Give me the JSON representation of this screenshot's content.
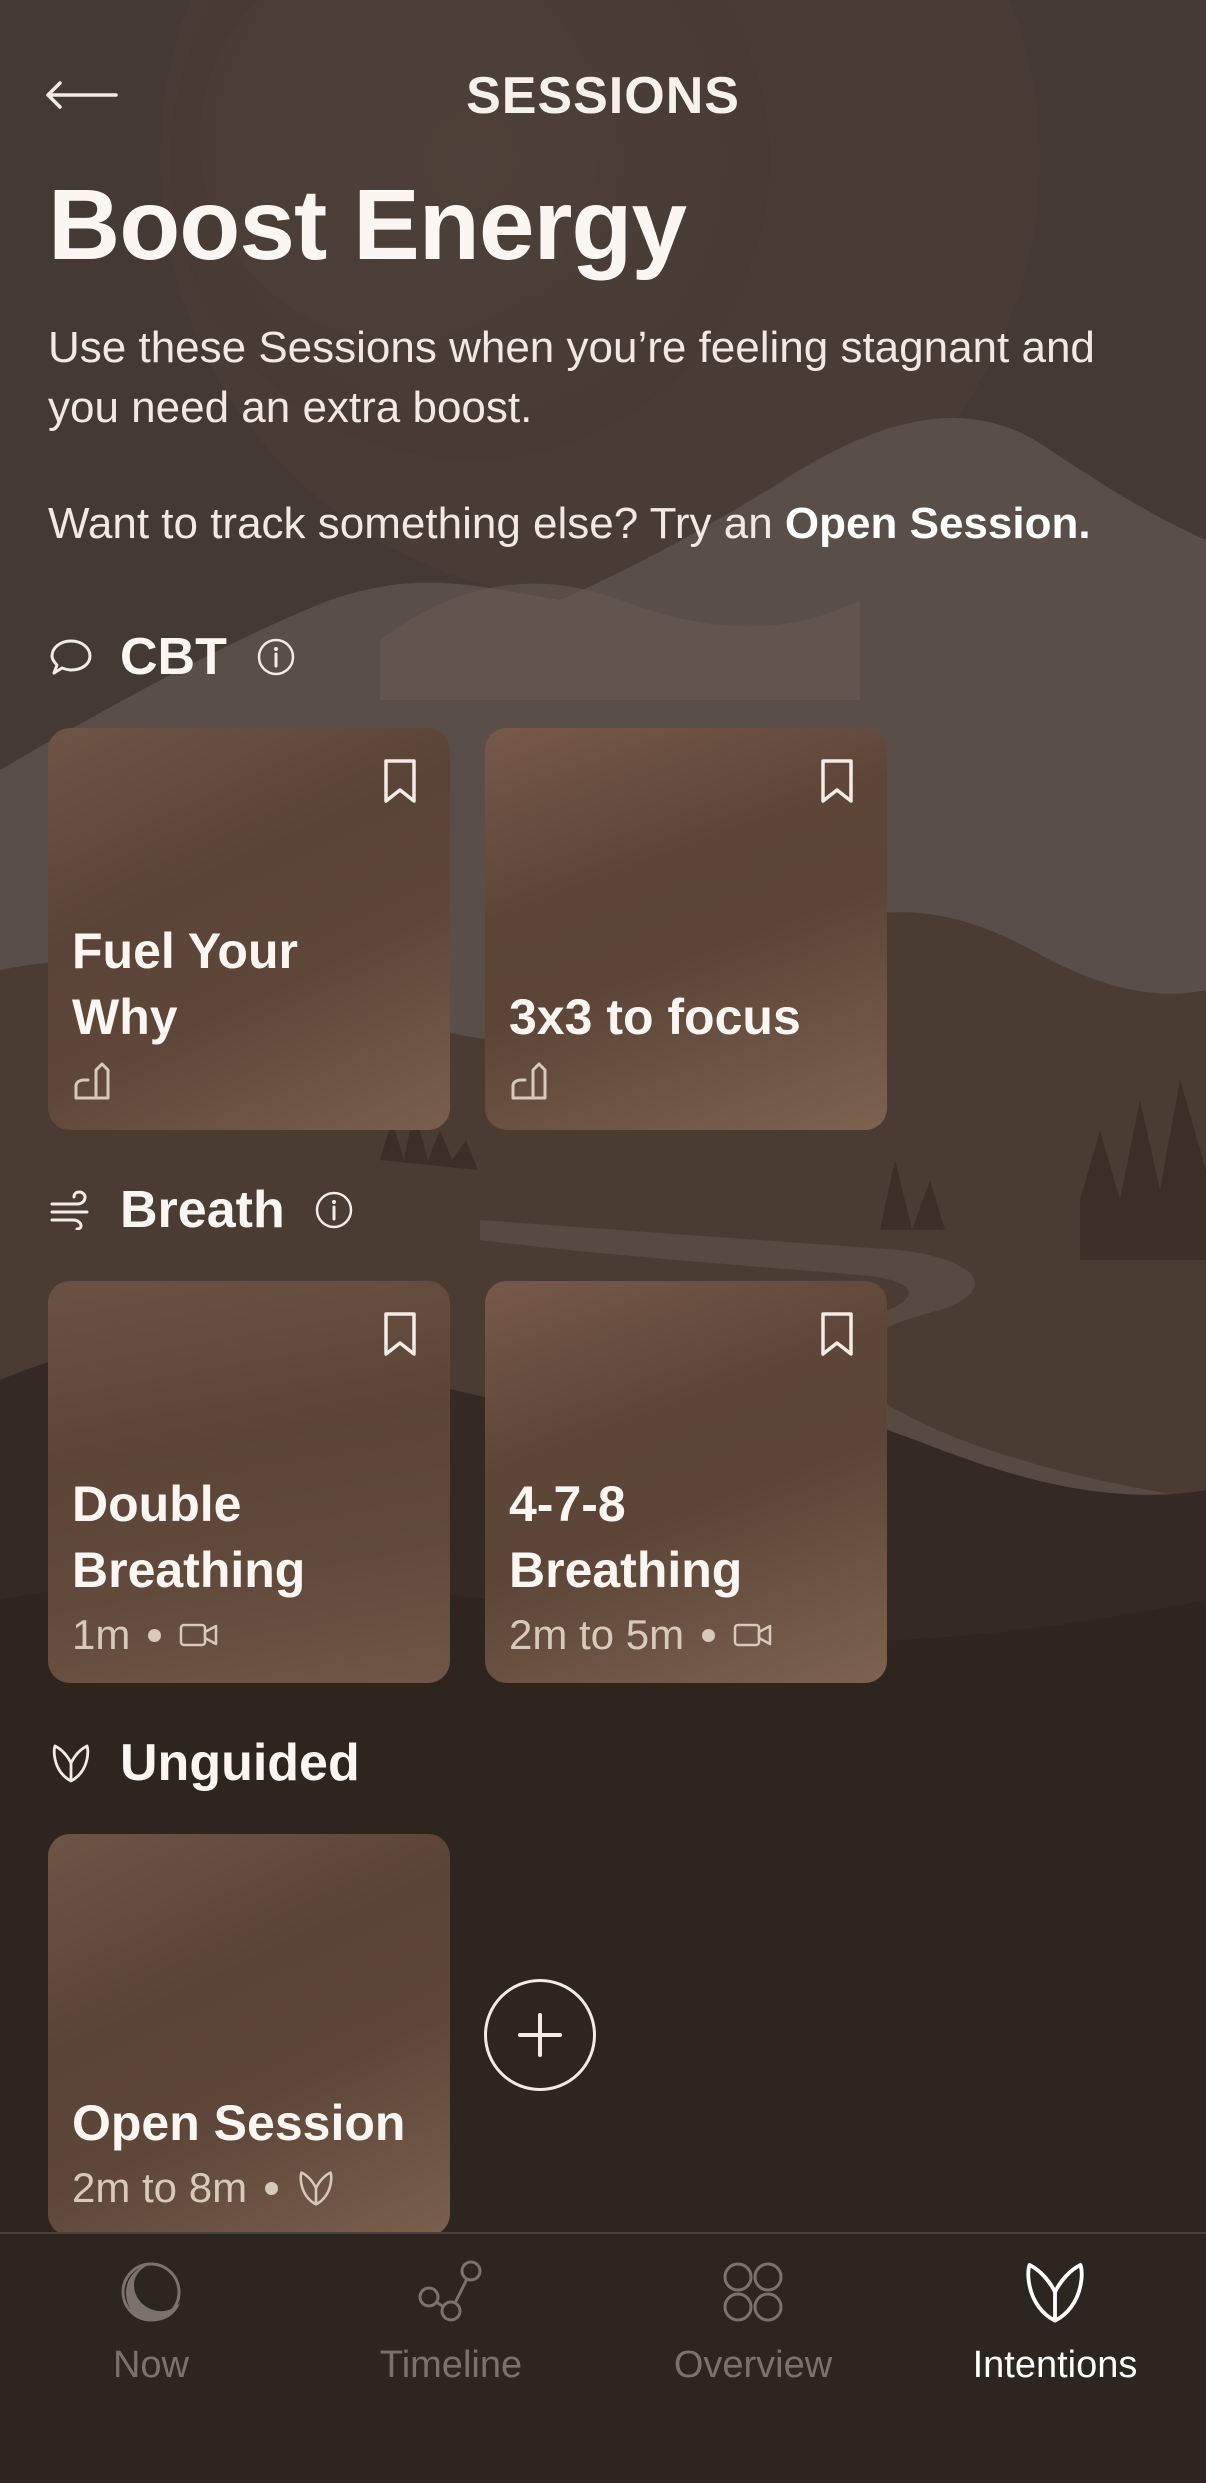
{
  "header": {
    "back_icon": "arrow-left-icon",
    "title": "SESSIONS"
  },
  "page": {
    "title": "Boost Energy",
    "description": "Use these Sessions when you’re feeling stagnant and you need an extra boost.",
    "try_prefix": "Want to track something else? Try an ",
    "try_link": "Open Session."
  },
  "sections": [
    {
      "title": "CBT",
      "icon": "speech-bubble-icon",
      "info_icon": "info-icon",
      "cards": [
        {
          "title": "Fuel Your Why",
          "meta_text": "",
          "meta_icon": "journal-pen-icon",
          "bookmark": true
        },
        {
          "title": "3x3 to focus",
          "meta_text": "",
          "meta_icon": "journal-pen-icon",
          "bookmark": true
        }
      ]
    },
    {
      "title": "Breath",
      "icon": "wind-icon",
      "info_icon": "info-icon",
      "cards": [
        {
          "title": "Double Breathing",
          "meta_text": "1m",
          "meta_icon": "video-icon",
          "bookmark": true
        },
        {
          "title": "4-7-8 Breathing",
          "meta_text": "2m to 5m",
          "meta_icon": "video-icon",
          "bookmark": true
        }
      ]
    },
    {
      "title": "Unguided",
      "icon": "leaf-icon",
      "cards": [
        {
          "title": "Open Session",
          "meta_text": "2m to 8m",
          "meta_icon": "leaf-icon",
          "bookmark": false
        }
      ],
      "add_icon": "plus-circle-icon"
    }
  ],
  "tabs": [
    {
      "label": "Now",
      "icon": "moon-icon",
      "active": false
    },
    {
      "label": "Timeline",
      "icon": "nodes-icon",
      "active": false
    },
    {
      "label": "Overview",
      "icon": "four-circles-icon",
      "active": false
    },
    {
      "label": "Intentions",
      "icon": "leaf-icon",
      "active": true
    }
  ],
  "colors": {
    "background": "#3a3029",
    "card": "#5e4739",
    "text": "#f3ece6",
    "tab_active": "#ffffff",
    "tab_inactive": "#7d726b"
  }
}
